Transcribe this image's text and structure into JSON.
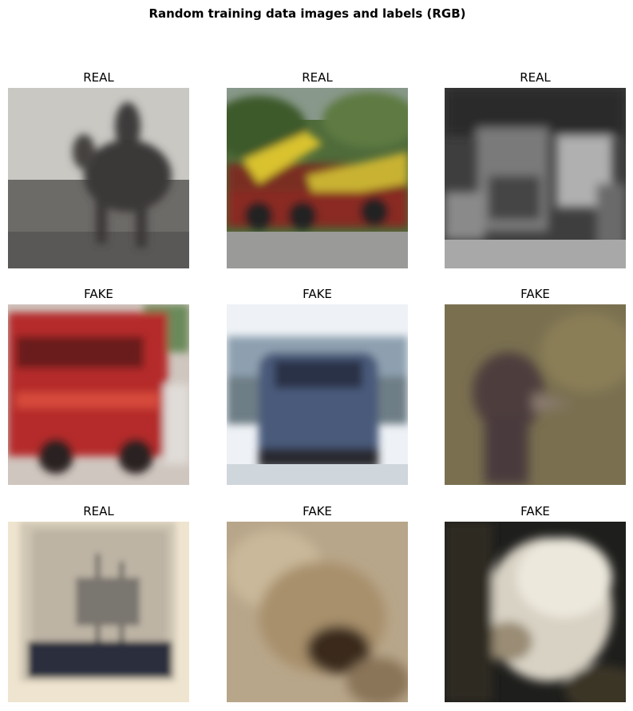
{
  "figure": {
    "title": "Random training data images and labels (RGB)"
  },
  "grid": [
    {
      "label": "REAL",
      "subject": "horse-rider-grayscale"
    },
    {
      "label": "REAL",
      "subject": "yellow-truck"
    },
    {
      "label": "REAL",
      "subject": "truck-grayscale"
    },
    {
      "label": "FAKE",
      "subject": "red-fire-truck"
    },
    {
      "label": "FAKE",
      "subject": "blue-car-rear"
    },
    {
      "label": "FAKE",
      "subject": "ostrich-head"
    },
    {
      "label": "REAL",
      "subject": "sailing-ship"
    },
    {
      "label": "FAKE",
      "subject": "tan-animal-blur"
    },
    {
      "label": "FAKE",
      "subject": "white-dog-dark-bg"
    }
  ]
}
